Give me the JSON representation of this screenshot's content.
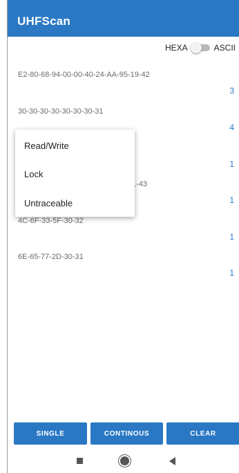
{
  "app": {
    "title": "UHFScan"
  },
  "format_toggle": {
    "left_label": "HEXA",
    "right_label": "ASCII"
  },
  "tags": [
    {
      "epc": "E2-80-68-94-00-00-40-24-AA-95-19-42",
      "count": "3"
    },
    {
      "epc": "30-30-30-30-30-30-30-31",
      "count": "4"
    },
    {
      "epc": "",
      "count": "1"
    },
    {
      "epc": "3-A1-43",
      "count": "1"
    },
    {
      "epc": "4C-6F-33-5F-30-32",
      "count": "1"
    },
    {
      "epc": "6E-65-77-2D-30-31",
      "count": "1"
    }
  ],
  "context_menu": {
    "items": [
      "Read/Write",
      "Lock",
      "Untraceable"
    ]
  },
  "buttons": {
    "single": "SINGLE",
    "continous": "CONTINOUS",
    "clear": "CLEAR"
  },
  "nav_icons": [
    "recents-square-icon",
    "home-circle-icon",
    "back-triangle-icon"
  ],
  "colors": {
    "primary": "#2a78c4",
    "count_text": "#2a78c4"
  }
}
